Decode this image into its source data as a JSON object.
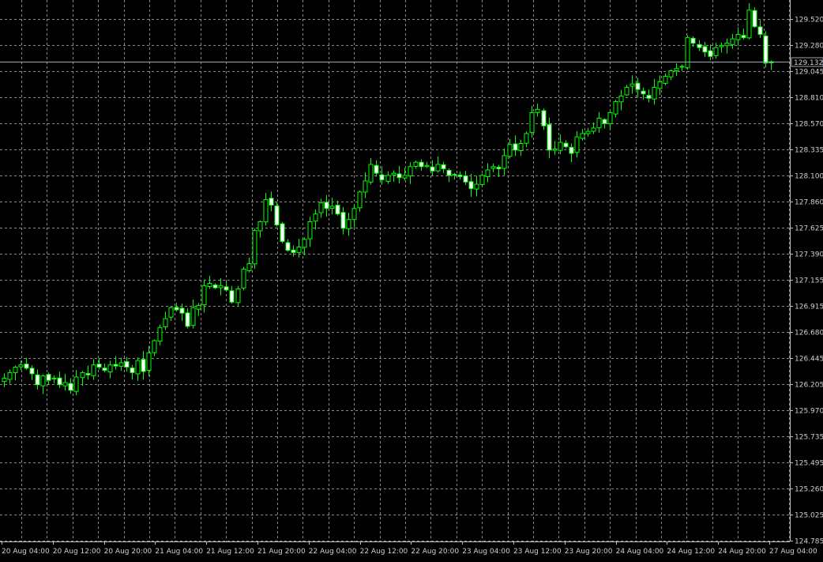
{
  "chart": {
    "instrument": "",
    "current_price": "129.132",
    "current_price_value": 129.132
  },
  "colors": {
    "background": "#000000",
    "grid": "#8a8a8a",
    "bull_candle": "#000000",
    "bear_candle": "#ffffff",
    "wick": "#00ff00",
    "axis_text": "#d0d0d0",
    "bid_line": "#9aa7b8"
  },
  "chart_data": {
    "type": "candlestick",
    "title": "",
    "xlabel": "",
    "ylabel": "",
    "ylim": [
      124.785,
      129.755
    ],
    "grid": true,
    "y_ticks": [
      "129.520",
      "129.280",
      "129.045",
      "128.810",
      "128.570",
      "128.335",
      "128.100",
      "127.860",
      "127.625",
      "127.390",
      "127.155",
      "126.915",
      "126.680",
      "126.445",
      "126.205",
      "125.970",
      "125.735",
      "125.495",
      "125.260",
      "125.025",
      "124.785"
    ],
    "x_ticks": [
      "20 Aug 04:00",
      "20 Aug 12:00",
      "20 Aug 20:00",
      "21 Aug 04:00",
      "21 Aug 12:00",
      "21 Aug 20:00",
      "22 Aug 04:00",
      "22 Aug 12:00",
      "22 Aug 20:00",
      "23 Aug 04:00",
      "23 Aug 12:00",
      "23 Aug 20:00",
      "24 Aug 04:00",
      "24 Aug 12:00",
      "24 Aug 20:00",
      "27 Aug 04:00"
    ],
    "period_hours_per_candle": 1,
    "close_series": [
      126.26,
      126.31,
      126.36,
      126.38,
      126.35,
      126.3,
      126.2,
      126.28,
      126.24,
      126.26,
      126.2,
      126.22,
      126.15,
      126.27,
      126.31,
      126.29,
      126.38,
      126.36,
      126.33,
      126.38,
      126.37,
      126.4,
      126.36,
      126.31,
      126.42,
      126.32,
      126.49,
      126.6,
      126.72,
      126.8,
      126.9,
      126.88,
      126.85,
      126.73,
      126.9,
      126.92,
      127.1,
      127.12,
      127.08,
      127.1,
      127.06,
      126.95,
      127.07,
      127.25,
      127.3,
      127.6,
      127.68,
      127.88,
      127.83,
      127.65,
      127.5,
      127.42,
      127.4,
      127.45,
      127.52,
      127.68,
      127.75,
      127.85,
      127.8,
      127.82,
      127.75,
      127.62,
      127.7,
      127.8,
      127.95,
      128.05,
      128.2,
      128.12,
      128.06,
      128.1,
      128.12,
      128.08,
      128.1,
      128.18,
      128.22,
      128.18,
      128.19,
      128.14,
      128.2,
      128.16,
      128.1,
      128.11,
      128.09,
      128.04,
      127.98,
      128.02,
      128.1,
      128.15,
      128.18,
      128.16,
      128.28,
      128.38,
      128.33,
      128.39,
      128.48,
      128.67,
      128.7,
      128.55,
      128.33,
      128.34,
      128.4,
      128.36,
      128.3,
      128.45,
      128.48,
      128.5,
      128.53,
      128.62,
      128.57,
      128.67,
      128.77,
      128.82,
      128.9,
      128.93,
      128.88,
      128.84,
      128.8,
      128.9,
      128.95,
      129.0,
      129.05,
      129.07,
      129.09,
      129.35,
      129.3,
      129.26,
      129.22,
      129.18,
      129.26,
      129.28,
      129.3,
      129.34,
      129.38,
      129.35,
      129.6,
      129.45,
      129.38,
      129.12,
      129.132
    ]
  }
}
